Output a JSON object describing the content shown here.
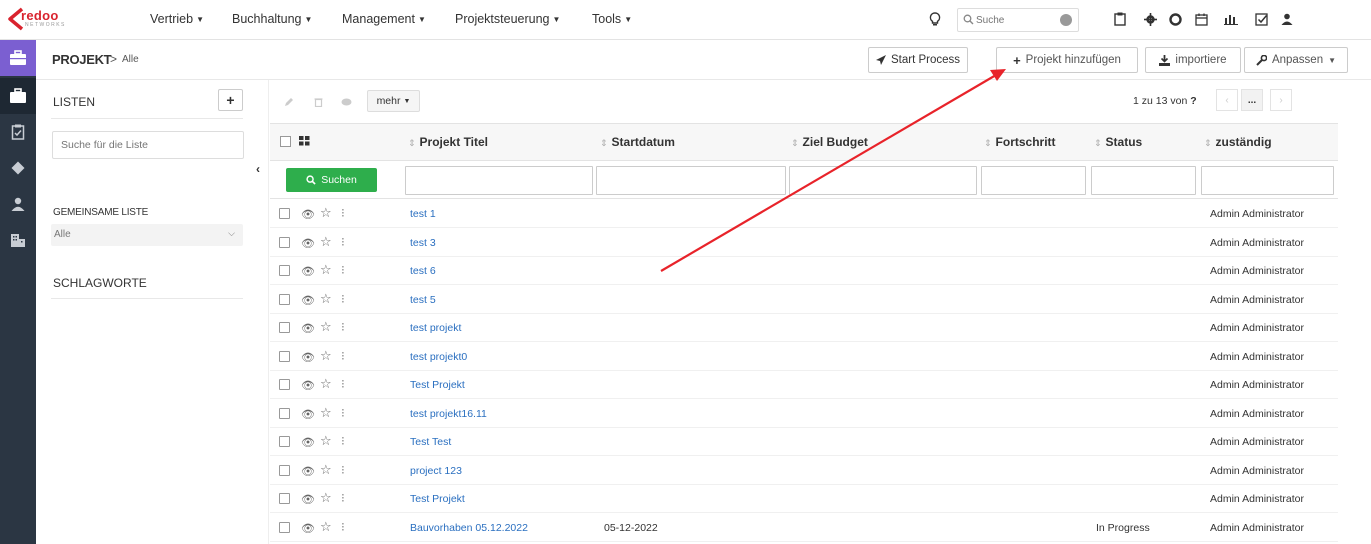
{
  "brand": {
    "name": "redoo",
    "tagline": "NETWORKS"
  },
  "topnav": {
    "menus": [
      {
        "label": "Vertrieb"
      },
      {
        "label": "Buchhaltung"
      },
      {
        "label": "Management"
      },
      {
        "label": "Projektsteuerung"
      },
      {
        "label": "Tools"
      }
    ],
    "search_placeholder": "Suche"
  },
  "breadcrumb": {
    "module": "PROJEKT",
    "separator": ">",
    "view": "Alle"
  },
  "actions": {
    "start_process": "Start Process",
    "add_project": "Projekt hinzufügen",
    "import": "importiere",
    "customize": "Anpassen"
  },
  "lists_panel": {
    "title": "LISTEN",
    "search_placeholder": "Suche für die Liste",
    "shared_title": "GEMEINSAME LISTE",
    "shared_selected": "Alle",
    "tags_title": "SCHLAGWORTE"
  },
  "table_toolbar": {
    "more": "mehr"
  },
  "pager": {
    "text": "1 zu 13 von",
    "total_icon": "?",
    "more": "..."
  },
  "columns": [
    "Projekt Titel",
    "Startdatum",
    "Ziel Budget",
    "Fortschritt",
    "Status",
    "zuständig"
  ],
  "search_button": "Suchen",
  "rows": [
    {
      "title": "test 1",
      "start": "",
      "status": "",
      "owner": "Admin Administrator"
    },
    {
      "title": "test 3",
      "start": "",
      "status": "",
      "owner": "Admin Administrator"
    },
    {
      "title": "test 6",
      "start": "",
      "status": "",
      "owner": "Admin Administrator"
    },
    {
      "title": "test 5",
      "start": "",
      "status": "",
      "owner": "Admin Administrator"
    },
    {
      "title": "test projekt",
      "start": "",
      "status": "",
      "owner": "Admin Administrator"
    },
    {
      "title": "test projekt0",
      "start": "",
      "status": "",
      "owner": "Admin Administrator"
    },
    {
      "title": "Test Projekt",
      "start": "",
      "status": "",
      "owner": "Admin Administrator"
    },
    {
      "title": "test projekt16.11",
      "start": "",
      "status": "",
      "owner": "Admin Administrator"
    },
    {
      "title": "Test Test",
      "start": "",
      "status": "",
      "owner": "Admin Administrator"
    },
    {
      "title": "project 123",
      "start": "",
      "status": "",
      "owner": "Admin Administrator"
    },
    {
      "title": "Test Projekt",
      "start": "",
      "status": "",
      "owner": "Admin Administrator"
    },
    {
      "title": "Bauvorhaben 05.12.2022",
      "start": "05-12-2022",
      "status": "In Progress",
      "owner": "Admin Administrator"
    }
  ],
  "colors": {
    "rail": "#2b3643",
    "rail_active": "#7b5fd1",
    "link": "#2a6fc0",
    "search_green": "#2eae4c",
    "annotation_arrow": "#e8232a"
  }
}
